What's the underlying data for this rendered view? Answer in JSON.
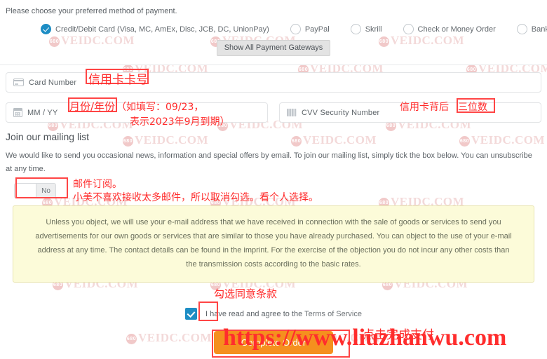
{
  "intro": {
    "text": "Please choose your preferred method of payment."
  },
  "payment_methods": {
    "options": [
      {
        "label": "Credit/Debit Card (Visa, MC, AmEx, Disc, JCB, DC, UnionPay)",
        "selected": true
      },
      {
        "label": "PayPal",
        "selected": false
      },
      {
        "label": "Skrill",
        "selected": false
      },
      {
        "label": "Check or Money Order",
        "selected": false
      },
      {
        "label": "Bank Wire Transfer",
        "selected": false
      }
    ],
    "show_all_label": "Show All Payment Gateways"
  },
  "card_form": {
    "card_number": {
      "label": "Card Number",
      "placeholder": "Card Number",
      "value": "",
      "icon": "credit-card-icon"
    },
    "expiry": {
      "label": "MM / YY",
      "placeholder": "MM / YY",
      "value": "",
      "icon": "calendar-icon"
    },
    "cvv": {
      "label": "CVV Security Number",
      "placeholder": "CVV Security Number",
      "value": "",
      "icon": "cvv-stripe-icon"
    }
  },
  "mailing_list": {
    "heading": "Join our mailing list",
    "body": "We would like to send you occasional news, information and special offers by email. To join our mailing list, simply tick the box below. You can unsubscribe at any time.",
    "toggle_value": "No",
    "notice": "Unless you object, we will use your e-mail address that we have received in connection with the sale of goods or services to send you advertisements for our own goods or services that are similar to those you have already purchased. You can object to the use of your e-mail address at any time. The contact details can be found in the imprint. For the exercise of the objection you do not incur any other costs than the transmission costs according to the basic rates."
  },
  "terms": {
    "checked": true,
    "prefix": "I have read and agree to the ",
    "link": "Terms of Service"
  },
  "submit": {
    "label": "Complete Order",
    "color": "#f5901e"
  },
  "annotations": {
    "card_number": "信用卡卡号",
    "expiry_line1": "月份/年份",
    "expiry_line1_suffix": "（如填写：09/23，",
    "expiry_line2": "表示2023年9月到期）",
    "cvv_prefix": "信用卡背后",
    "cvv_boxed": "三位数",
    "mail_line1": "邮件订阅。",
    "mail_line2": "小美不喜欢接收太多邮件，所以取消勾选。看个人选择。",
    "terms_note": "勾选同意条款",
    "submit_note": "点击完成支付",
    "url": "https://www.liuzhanwu.com",
    "color": "#ff2b2b"
  },
  "watermark": {
    "text": "VEIDC.COM",
    "badge": "680"
  }
}
